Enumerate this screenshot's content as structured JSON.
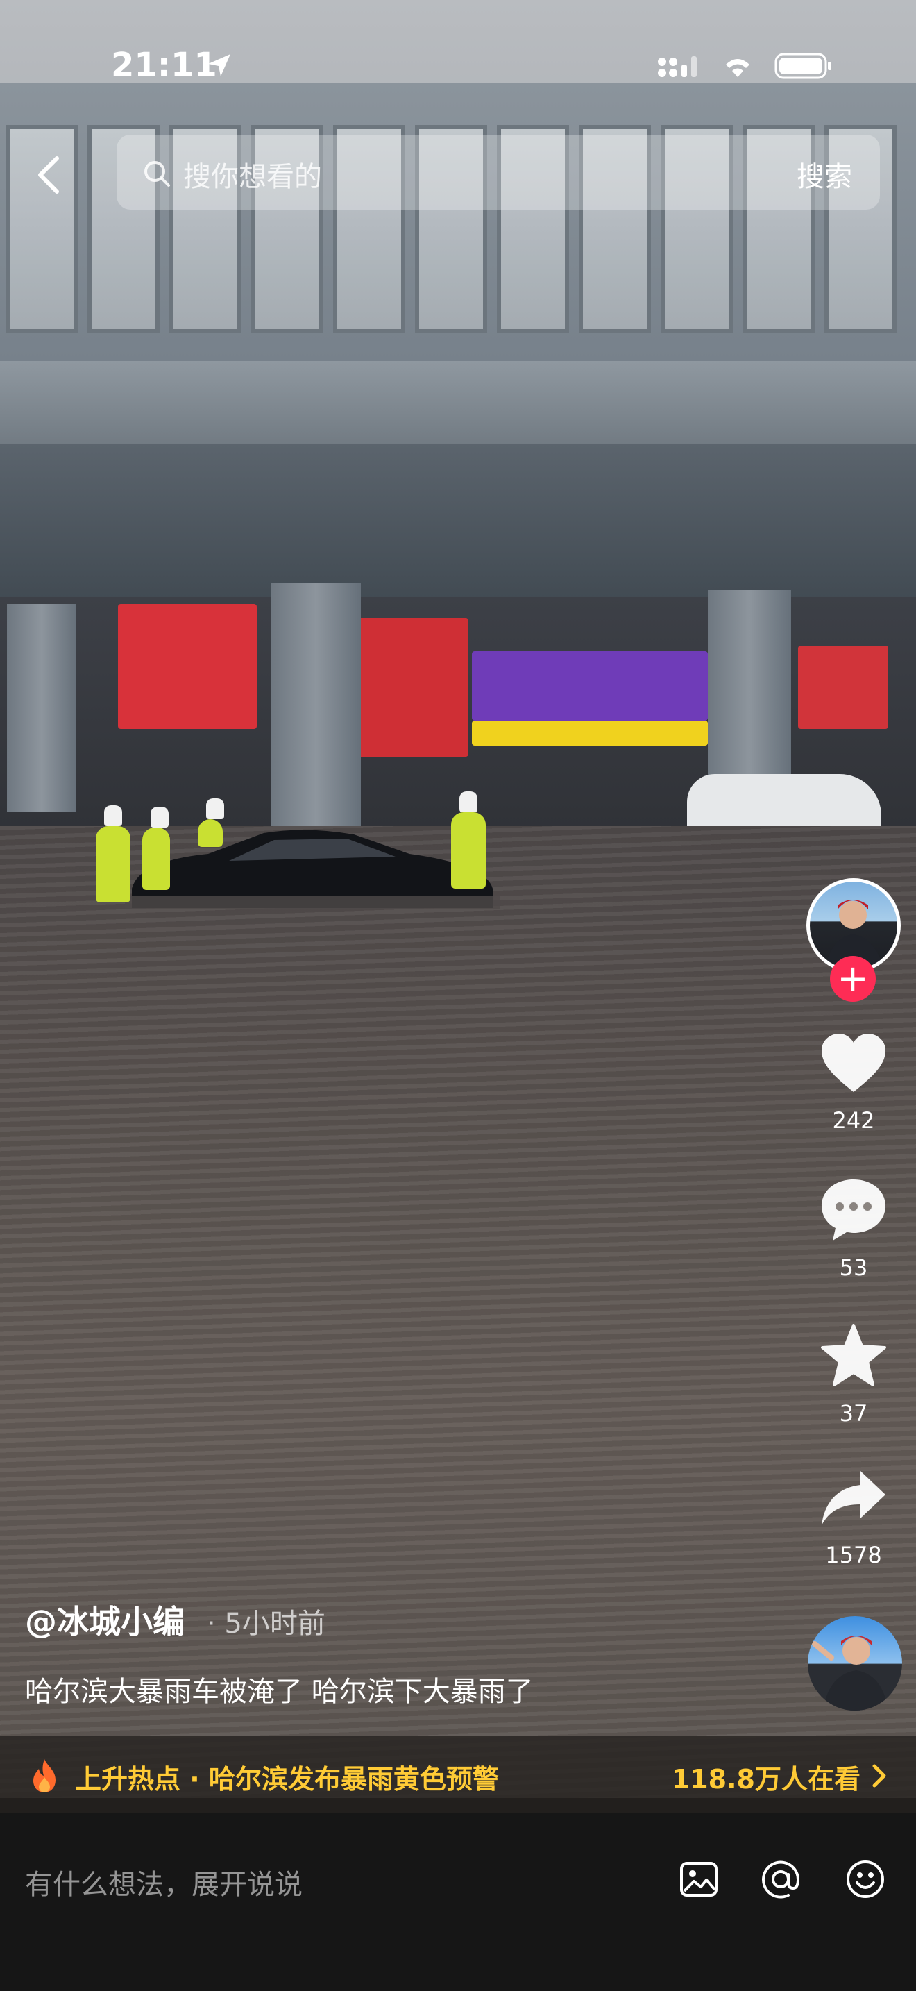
{
  "status_bar": {
    "time": "21:11"
  },
  "search": {
    "placeholder": "搜你想看的",
    "button_label": "搜索"
  },
  "actions": {
    "like_count": "242",
    "comment_count": "53",
    "favorite_count": "37",
    "share_count": "1578"
  },
  "video": {
    "author": "@冰城小编",
    "time_ago": "· 5小时前",
    "description": "哈尔滨大暴雨车被淹了 哈尔滨下大暴雨了"
  },
  "hot_topic": {
    "label": "上升热点 · 哈尔滨发布暴雨黄色预警",
    "watching": "118.8万人在看"
  },
  "comment_bar": {
    "placeholder": "有什么想法，展开说说"
  },
  "colors": {
    "accent_red": "#fe2c55",
    "hot_yellow": "#ffcb36"
  }
}
